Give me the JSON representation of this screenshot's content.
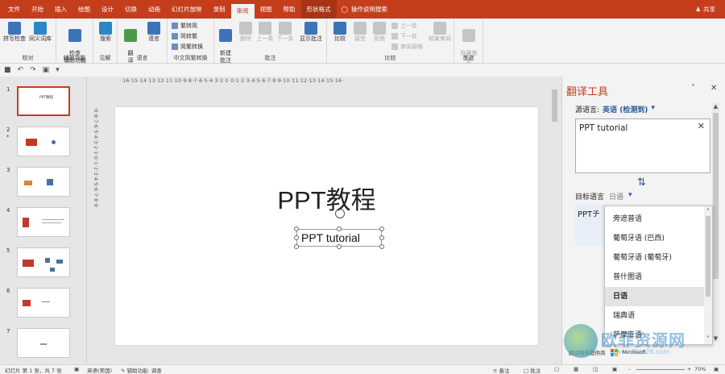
{
  "tabs": [
    "文件",
    "开始",
    "插入",
    "绘图",
    "设计",
    "切换",
    "动画",
    "幻灯片放映",
    "录制",
    "审阅",
    "视图",
    "帮助",
    "形状格式"
  ],
  "active_tab": "审阅",
  "tell_me": "操作说明搜索",
  "share": "共享",
  "ribbon": {
    "groups": {
      "proofing": "校对",
      "accessibility": "辅助功能",
      "insights": "见解",
      "language": "语言",
      "chinese_conversion": "中文简繁转换",
      "comments": "批注",
      "compare": "比较",
      "ink": "墨迹"
    },
    "buttons": {
      "spell_check": "拼写检查",
      "thesaurus": "同义词库",
      "check_accessibility": "检查\n辅助功能",
      "search": "搜索",
      "translate": "翻\n译",
      "language": "语言",
      "trad_to_simp": "繁转简",
      "simp_to_trad": "简转繁",
      "simp_trad_conv": "简繁转换",
      "new_comment": "新建\n批注",
      "delete": "删除",
      "previous": "上一条",
      "next": "下一条",
      "show_comments": "显示批注",
      "compare": "比较",
      "accept": "接受",
      "reject": "拒绝",
      "prev_change": "上一处",
      "next_change": "下一处",
      "reviewing_pane": "审阅窗格",
      "end_review": "结束审阅",
      "hide_ink": "隐藏墨\n迹"
    }
  },
  "thumbnails": [
    "1",
    "2",
    "3",
    "4",
    "5",
    "6",
    "7"
  ],
  "thumb1_title": "PPT教程",
  "slide": {
    "title": "PPT教程",
    "textbox": "PPT tutorial"
  },
  "ruler_h": "·16·15·14·13·12·11·10·9·8·7·6·5·4·3·2·1·0·1·2·3·4·5·6·7·8·9·10·11·12·13·14·15·16·",
  "ruler_v": "·9·8·7·6·5·4·3·2·1·0·1·2·3·4·5·6·7·8·9·",
  "translator": {
    "title": "翻译工具",
    "source_label": "源语言:",
    "source_lang": "英语 (检测到)",
    "source_text": "PPT tutorial",
    "target_label": "目标语言",
    "target_lang": "日语",
    "target_text": "PPTチ",
    "footer_text": "翻译服务提供商",
    "footer_brand": "Microsoft",
    "dropdown": [
      "旁遮普语",
      "葡萄牙语 (巴西)",
      "葡萄牙语 (葡萄牙)",
      "普什图语",
      "日语",
      "瑞典语",
      "萨摩亚语"
    ],
    "dropdown_selected": "日语"
  },
  "status": {
    "slide_info": "幻灯片 第 1 张，共 7 张",
    "language": "英语(美国)",
    "accessibility": "辅助功能: 调查",
    "notes": "备注",
    "comments": "批注",
    "zoom": "70%"
  },
  "watermark": {
    "text": "欧菲资源网",
    "url": "www.office26.com"
  },
  "colors": {
    "accent": "#c43e1c",
    "link": "#2b579a"
  }
}
